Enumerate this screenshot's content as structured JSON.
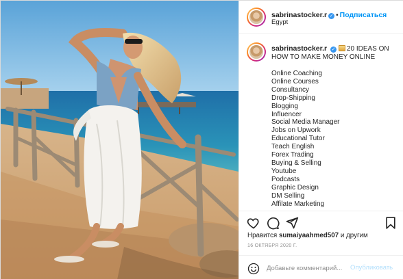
{
  "post": {
    "author": "sabrinastocker.r",
    "follow_label": "Подписаться",
    "location": "Egypt",
    "verified_mark": "✓",
    "dot": "•"
  },
  "caption": {
    "author": "sabrinastocker.r",
    "headline": "20 IDEAS ON HOW TO MAKE MONEY ONLINE",
    "emoji_icon": "sunset-emoji",
    "ideas": [
      "Online Coaching",
      "Online Courses",
      "Consultancy",
      "Drop-Shipping",
      "Blogging",
      "Influencer",
      "Social Media Manager",
      "Jobs on Upwork",
      "Educational Tutor",
      "Teach English",
      "Forex Trading",
      "Buying & Selling",
      "Youtube",
      "Podcasts",
      "Graphic Design",
      "DM Selling",
      "Affilate Marketing"
    ]
  },
  "actions": {
    "icons": [
      "heart-icon",
      "comment-icon",
      "share-icon",
      "bookmark-icon"
    ],
    "likes_prefix": "Нравится",
    "likes_user": "sumaiyaahmed507",
    "likes_suffix": "и другим",
    "date": "16 ОКТЯБРЯ 2020 Г."
  },
  "comment_box": {
    "placeholder": "Добавьте комментарий...",
    "publish_label": "Опубликовать",
    "icon": "smile-icon"
  },
  "colors": {
    "link": "#0095f6",
    "text": "#262626",
    "muted": "#8e8e8e",
    "publish_disabled": "#b2dffc",
    "border": "#dbdbdb"
  }
}
